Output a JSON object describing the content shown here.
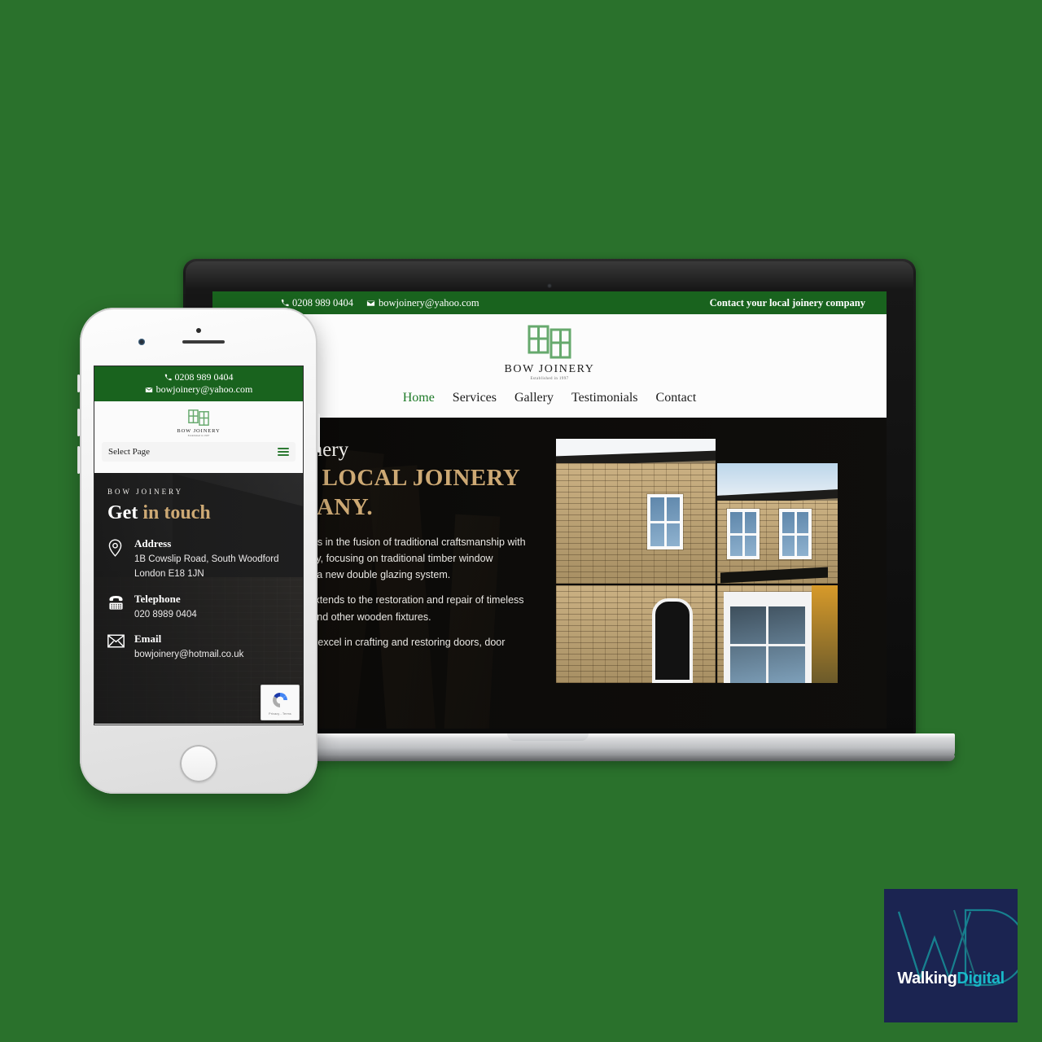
{
  "background_color": "#2a712c",
  "brand": {
    "name": "BOW JOINERY",
    "tagline": "Established in 1997",
    "logo_icon": "window-panes-icon",
    "green": "#19631e",
    "accent_gold": "#cda974"
  },
  "desktop": {
    "topbar": {
      "phone_icon": "phone-icon",
      "phone": "0208 989 0404",
      "email_icon": "envelope-icon",
      "email": "bowjoinery@yahoo.com",
      "tagline": "Contact your local joinery company"
    },
    "nav": [
      {
        "label": "Home",
        "active": true
      },
      {
        "label": "Services",
        "active": false
      },
      {
        "label": "Gallery",
        "active": false
      },
      {
        "label": "Testimonials",
        "active": false
      },
      {
        "label": "Contact",
        "active": false
      }
    ],
    "hero": {
      "eyebrow": "Bow Joinery",
      "title": "YOUR LOCAL JOINERY COMPANY.",
      "paragraphs": [
        "Our specialty lies in the fusion of traditional craftsmanship with energy efficiency, focusing on traditional timber window restoration with a new double glazing system.",
        "Our expertise extends to the restoration and repair of timeless sash windows and other wooden fixtures.",
        "Additionally, we excel in crafting and restoring doors, door"
      ],
      "collage_alt": "Victorian brick house with restored white sash windows"
    }
  },
  "mobile": {
    "topbar": {
      "phone_icon": "phone-icon",
      "phone": "0208 989 0404",
      "email_icon": "envelope-icon",
      "email": "bowjoinery@yahoo.com"
    },
    "menu": {
      "select_label": "Select Page",
      "menu_icon": "hamburger-icon"
    },
    "contact": {
      "eyebrow": "BOW JOINERY",
      "title_plain": "Get ",
      "title_accent": "in touch",
      "items": [
        {
          "icon": "map-pin-icon",
          "label": "Address",
          "value": "1B Cowslip Road, South Woodford\nLondon E18 1JN"
        },
        {
          "icon": "telephone-icon",
          "label": "Telephone",
          "value": "020 8989 0404"
        },
        {
          "icon": "envelope-icon",
          "label": "Email",
          "value": "bowjoinery@hotmail.co.uk"
        }
      ],
      "recaptcha": {
        "icon": "recaptcha-icon",
        "text": "Privacy - Terms"
      }
    }
  },
  "watermark": {
    "monogram": "WD",
    "word_part1": "Walking",
    "word_part2": "Digital",
    "bg": "#1b2451",
    "accent": "#19b9c9"
  }
}
